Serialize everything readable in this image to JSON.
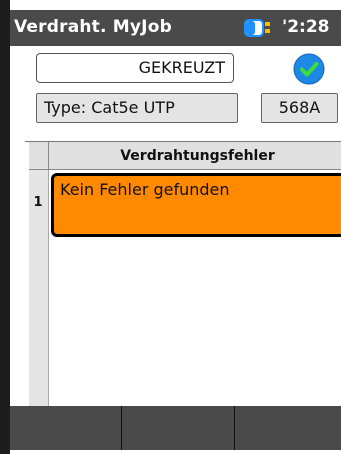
{
  "header": {
    "title": "Verdraht. MyJob",
    "clock": "'2:28",
    "battery_icon": "battery-icon",
    "background": "#4a4a4a"
  },
  "result": {
    "status": "GEKREUZT",
    "pass_icon": "check-circle-icon",
    "pass_color": "#1e88e5"
  },
  "cable": {
    "type": "Type: Cat5e UTP",
    "standard": "568A"
  },
  "table": {
    "header": "Verdrahtungsfehler",
    "rows": [
      {
        "num": "1",
        "text": "Kein Fehler gefunden",
        "highlight_color": "#ff8a00"
      }
    ]
  },
  "softkeys": [
    "",
    "",
    ""
  ]
}
